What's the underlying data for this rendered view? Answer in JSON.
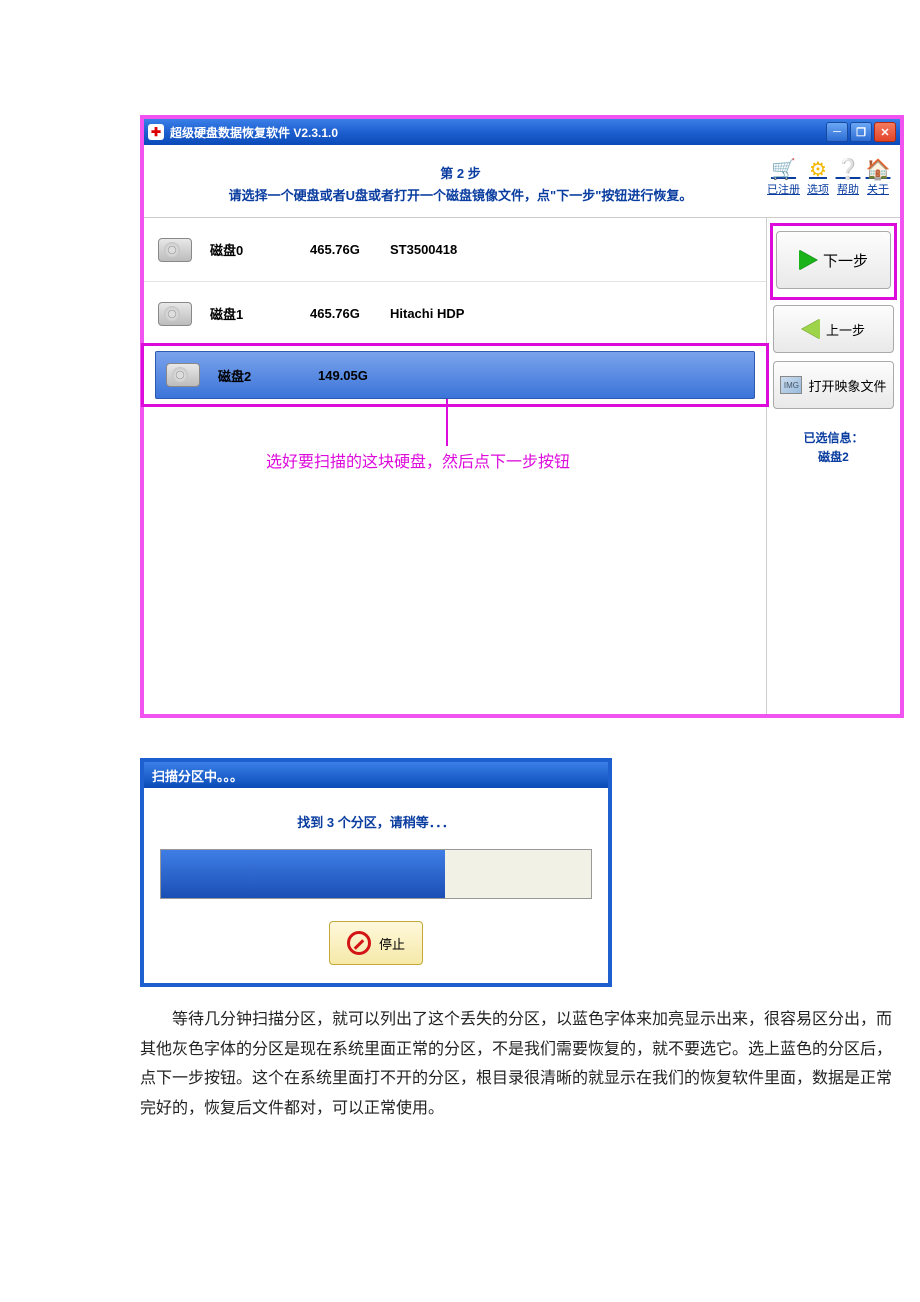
{
  "window": {
    "title": "超级硬盘数据恢复软件  V2.3.1.0",
    "step_number": "第 2 步",
    "step_instruction": "请选择一个硬盘或者U盘或者打开一个磁盘镜像文件，点\"下一步\"按钮进行恢复。"
  },
  "toolbar": {
    "registered": "已注册",
    "options": "选项",
    "help": "帮助",
    "about": "关于"
  },
  "disks": [
    {
      "name": "磁盘0",
      "size": "465.76G",
      "model": "ST3500418"
    },
    {
      "name": "磁盘1",
      "size": "465.76G",
      "model": "Hitachi HDP"
    },
    {
      "name": "磁盘2",
      "size": "149.05G",
      "model": ""
    }
  ],
  "buttons": {
    "next": "下一步",
    "prev": "上一步",
    "open_image": "打开映象文件"
  },
  "selected_info": {
    "label": "已选信息：",
    "value": "磁盘2"
  },
  "annotation": "选好要扫描的这块硬盘，然后点下一步按钮",
  "progress": {
    "title": "扫描分区中。。。",
    "message": "找到 3 个分区，请稍等．．．",
    "percent": 66,
    "stop": "停止"
  },
  "paragraph": "等待几分钟扫描分区，就可以列出了这个丢失的分区，以蓝色字体来加亮显示出来，很容易区分出，而其他灰色字体的分区是现在系统里面正常的分区，不是我们需要恢复的，就不要选它。选上蓝色的分区后，点下一步按钮。这个在系统里面打不开的分区，根目录很清晰的就显示在我们的恢复软件里面，数据是正常完好的，恢复后文件都对，可以正常使用。"
}
